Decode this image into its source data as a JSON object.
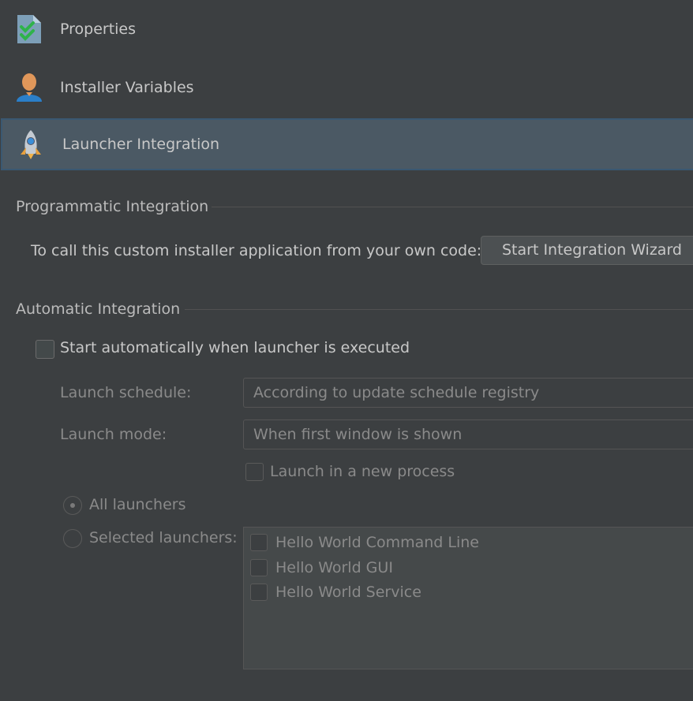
{
  "nav": {
    "items": [
      {
        "label": "Properties",
        "icon": "properties-icon"
      },
      {
        "label": "Installer Variables",
        "icon": "user-icon"
      },
      {
        "label": "Launcher Integration",
        "icon": "rocket-icon",
        "selected": true
      }
    ]
  },
  "programmatic": {
    "title": "Programmatic Integration",
    "description": "To call this custom installer application from your own code:",
    "button_label": "Start Integration Wizard"
  },
  "automatic": {
    "title": "Automatic Integration",
    "start_auto_label": "Start automatically when launcher is executed",
    "start_auto_checked": false,
    "schedule_label": "Launch schedule:",
    "schedule_value": "According to update schedule registry",
    "mode_label": "Launch mode:",
    "mode_value": "When first window is shown",
    "new_process_label": "Launch in a new process",
    "new_process_checked": false,
    "all_launchers_label": "All launchers",
    "all_launchers_selected": true,
    "selected_launchers_label": "Selected launchers:",
    "launchers": [
      {
        "label": "Hello World Command Line",
        "checked": false
      },
      {
        "label": "Hello World GUI",
        "checked": false
      },
      {
        "label": "Hello World Service",
        "checked": false
      }
    ]
  },
  "colors": {
    "background": "#3c3f41",
    "selection": "#4b5964",
    "selection_border": "#3a5872"
  }
}
